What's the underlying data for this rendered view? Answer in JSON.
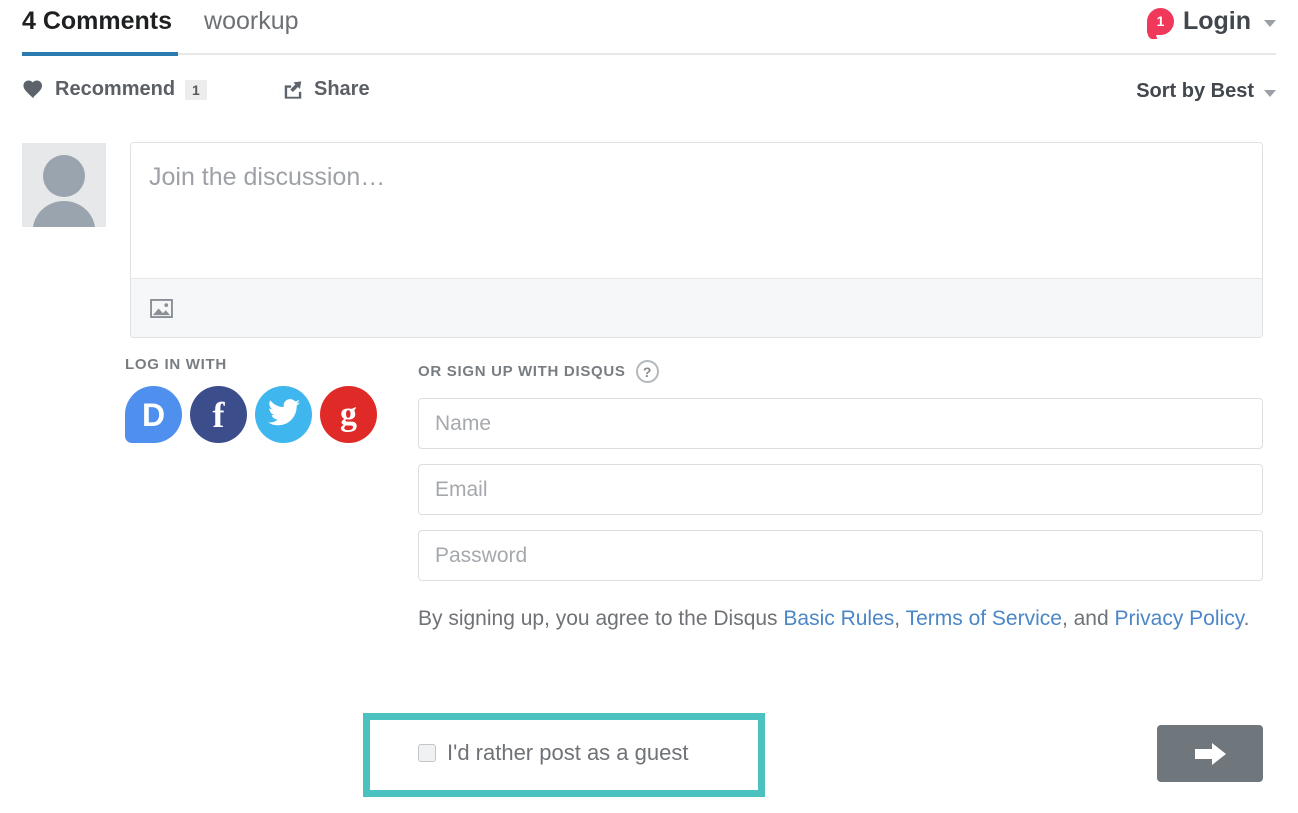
{
  "header": {
    "tabs": [
      {
        "label": "4 Comments",
        "active": true
      },
      {
        "label": "woorkup",
        "active": false
      }
    ],
    "login": {
      "badge_count": "1",
      "label": "Login",
      "caret": "chevron-down-icon"
    }
  },
  "actionbar": {
    "recommend_label": "Recommend",
    "recommend_count": "1",
    "share_label": "Share",
    "sort_label": "Sort by Best"
  },
  "composer": {
    "placeholder": "Join the discussion…",
    "toolbar_icon": "image-upload-icon"
  },
  "login_with": {
    "title": "LOG IN WITH",
    "providers": [
      {
        "name": "Disqus",
        "glyph": "D",
        "color": "#4f8fee"
      },
      {
        "name": "Facebook",
        "glyph": "f",
        "color": "#3c4d8c"
      },
      {
        "name": "Twitter",
        "glyph": "\u0001",
        "color": "#3fb7ee"
      },
      {
        "name": "Google",
        "glyph": "g",
        "color": "#e02a27"
      }
    ]
  },
  "signup": {
    "title": "OR SIGN UP WITH DISQUS",
    "help_glyph": "?",
    "fields": [
      {
        "name": "name",
        "placeholder": "Name",
        "value": ""
      },
      {
        "name": "email",
        "placeholder": "Email",
        "value": ""
      },
      {
        "name": "password",
        "placeholder": "Password",
        "value": ""
      }
    ],
    "terms": {
      "prefix": "By signing up, you agree to the Disqus ",
      "link1": "Basic Rules",
      "sep1": ", ",
      "link2": "Terms of Service",
      "sep2": ", and ",
      "link3": "Privacy Policy",
      "suffix": "."
    }
  },
  "guest": {
    "label": "I'd rather post as a guest",
    "checked": false,
    "highlight_color": "#4cc2c0"
  },
  "submit": {
    "icon": "arrow-right-icon"
  },
  "colors": {
    "active_tab_underline": "#2a7cb0",
    "badge_red": "#f0385b",
    "link_blue": "#4b86c8",
    "submit_gray": "#6f767c"
  }
}
